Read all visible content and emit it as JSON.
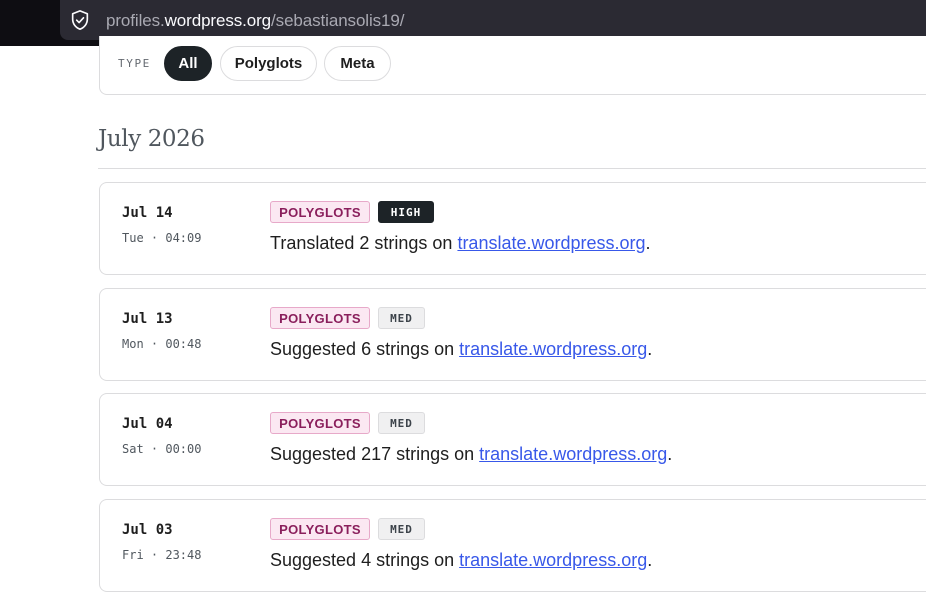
{
  "browser": {
    "url_prefix": "profiles.",
    "url_domain": "wordpress.org",
    "url_path": "/sebastiansolis19/"
  },
  "filters": {
    "label": "TYPE",
    "chips": [
      {
        "label": "All",
        "active": true
      },
      {
        "label": "Polyglots",
        "active": false
      },
      {
        "label": "Meta",
        "active": false
      }
    ]
  },
  "month_heading": "July 2026",
  "activities": [
    {
      "date": "Jul 14",
      "weekday_time": "Tue · 04:09",
      "team": "POLYGLOTS",
      "level": "HIGH",
      "text_before": "Translated 2 strings on ",
      "link": "translate.wordpress.org",
      "text_after": "."
    },
    {
      "date": "Jul 13",
      "weekday_time": "Mon · 00:48",
      "team": "POLYGLOTS",
      "level": "MED",
      "text_before": "Suggested 6 strings on ",
      "link": "translate.wordpress.org",
      "text_after": "."
    },
    {
      "date": "Jul 04",
      "weekday_time": "Sat · 00:00",
      "team": "POLYGLOTS",
      "level": "MED",
      "text_before": "Suggested 217 strings on ",
      "link": "translate.wordpress.org",
      "text_after": "."
    },
    {
      "date": "Jul 03",
      "weekday_time": "Fri · 23:48",
      "team": "POLYGLOTS",
      "level": "MED",
      "text_before": "Suggested 4 strings on ",
      "link": "translate.wordpress.org",
      "text_after": "."
    }
  ]
}
